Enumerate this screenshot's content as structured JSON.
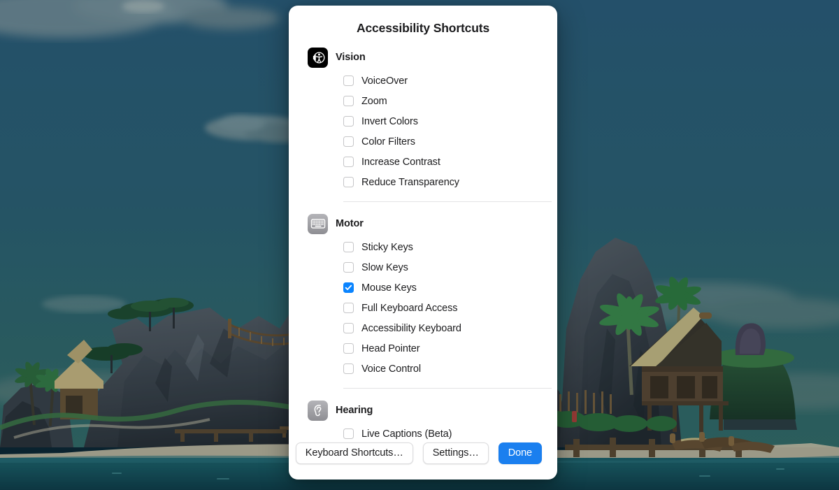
{
  "wallpaper": {
    "description": "tropical-island-illustration",
    "sky_top": "#2c5c78",
    "sky_bottom": "#2f6166",
    "water": "#1d5a61",
    "rock": "#474d55",
    "sand": "#d8cfba",
    "foliage": "#2e6b3c"
  },
  "dialog": {
    "title": "Accessibility Shortcuts",
    "accent_color": "#1a7fef",
    "sections": [
      {
        "title": "Vision",
        "icon": "accessibility-voiceover-icon",
        "icon_style": "dark",
        "options": [
          {
            "label": "VoiceOver",
            "checked": false
          },
          {
            "label": "Zoom",
            "checked": false
          },
          {
            "label": "Invert Colors",
            "checked": false
          },
          {
            "label": "Color Filters",
            "checked": false
          },
          {
            "label": "Increase Contrast",
            "checked": false
          },
          {
            "label": "Reduce Transparency",
            "checked": false
          }
        ]
      },
      {
        "title": "Motor",
        "icon": "keyboard-icon",
        "icon_style": "grey",
        "options": [
          {
            "label": "Sticky Keys",
            "checked": false
          },
          {
            "label": "Slow Keys",
            "checked": false
          },
          {
            "label": "Mouse Keys",
            "checked": true
          },
          {
            "label": "Full Keyboard Access",
            "checked": false
          },
          {
            "label": "Accessibility Keyboard",
            "checked": false
          },
          {
            "label": "Head Pointer",
            "checked": false
          },
          {
            "label": "Voice Control",
            "checked": false
          }
        ]
      },
      {
        "title": "Hearing",
        "icon": "ear-icon",
        "icon_style": "grey",
        "options": [
          {
            "label": "Live Captions (Beta)",
            "checked": false
          }
        ]
      }
    ],
    "buttons": [
      {
        "label": "Keyboard Shortcuts…",
        "style": "plain",
        "name": "keyboard-shortcuts-button"
      },
      {
        "label": "Settings…",
        "style": "plain",
        "name": "settings-button"
      },
      {
        "label": "Done",
        "style": "primary",
        "name": "done-button"
      }
    ]
  }
}
